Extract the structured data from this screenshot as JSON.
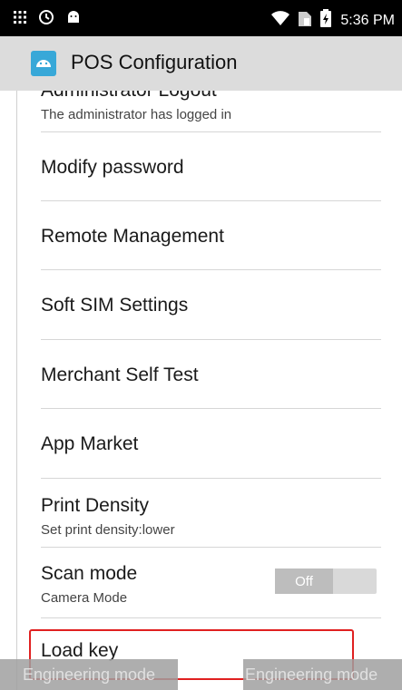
{
  "status_bar": {
    "time": "5:36 PM",
    "left_icons": [
      "grid-icon",
      "clock-icon",
      "android-icon"
    ],
    "right_icons": [
      "wifi-icon",
      "sim-icon",
      "battery-charging-icon"
    ]
  },
  "app_bar": {
    "title": "POS Configuration",
    "icon_color": "#38A8D8"
  },
  "settings": [
    {
      "title": "Administrator Logout",
      "summary": "The administrator has logged in"
    },
    {
      "title": "Modify password"
    },
    {
      "title": "Remote Management"
    },
    {
      "title": "Soft SIM Settings"
    },
    {
      "title": "Merchant Self Test"
    },
    {
      "title": "App Market"
    },
    {
      "title": "Print Density",
      "summary": "Set print density:lower"
    },
    {
      "title": "Scan mode",
      "summary": "Camera Mode",
      "toggle": "Off"
    },
    {
      "title": "Load key"
    }
  ],
  "overlay_buttons": {
    "left": "Engineering mode",
    "right": "Engineering mode"
  },
  "highlight_color": "#E02020"
}
